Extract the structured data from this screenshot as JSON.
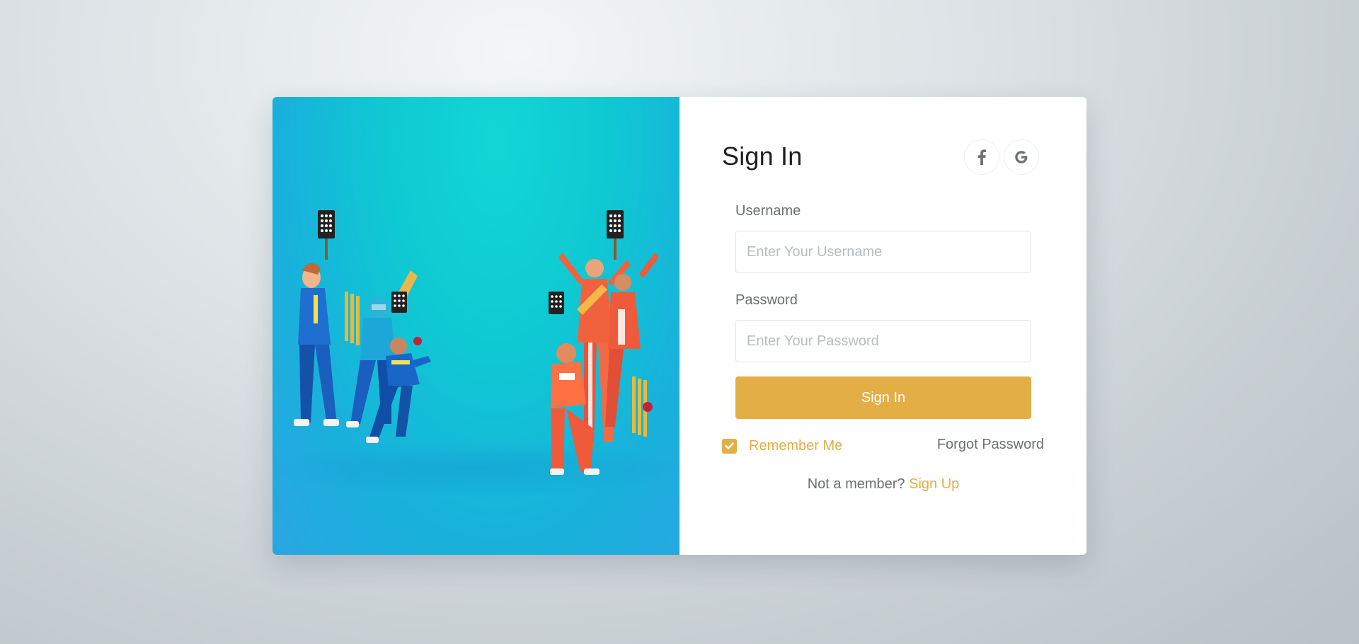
{
  "hero": {
    "image_description_icon": "cricket-players-illustration"
  },
  "form": {
    "title": "Sign In",
    "social": {
      "facebook_icon": "f",
      "google_icon": "G"
    },
    "username": {
      "label": "Username",
      "placeholder": "Enter Your Username",
      "value": ""
    },
    "password": {
      "label": "Password",
      "placeholder": "Enter Your Password",
      "value": ""
    },
    "submit_label": "Sign In",
    "remember": {
      "label": "Remember Me",
      "checked": true
    },
    "forgot_label": "Forgot Password",
    "signup_prompt": "Not a member?",
    "signup_link": "Sign Up"
  },
  "colors": {
    "accent": "#e4ae47",
    "hero_teal": "#12d6d6",
    "hero_blue": "#2aa6e0",
    "text_muted": "#6b6f73",
    "title": "#1f1f1f"
  }
}
